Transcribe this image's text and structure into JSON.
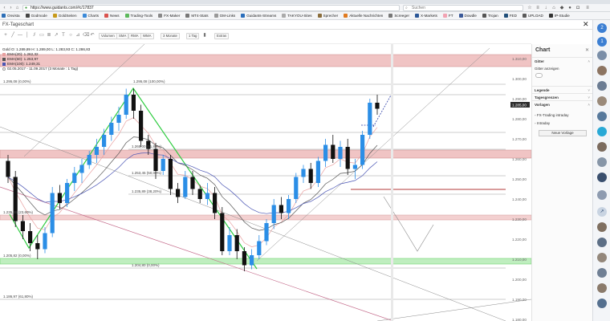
{
  "browser": {
    "url": "https://www.guidants.com/#c/17837",
    "search_placeholder": "Suchen",
    "bookmarks": [
      {
        "label": "Onvista",
        "color": "#2d6fb7"
      },
      {
        "label": "Godmode",
        "color": "#444444"
      },
      {
        "label": "GoldSeiten",
        "color": "#c79a1a"
      },
      {
        "label": "Charts",
        "color": "#3c8ad8"
      },
      {
        "label": "News",
        "color": "#d9534f"
      },
      {
        "label": "Trading-Tools",
        "color": "#5cb85c"
      },
      {
        "label": "FX-Maker",
        "color": "#888888"
      },
      {
        "label": "MT4-Stats",
        "color": "#777777"
      },
      {
        "label": "GM-Links",
        "color": "#999999"
      },
      {
        "label": "Guidants-Streams",
        "color": "#2a6ebb"
      },
      {
        "label": "TAKYOU-Sites",
        "color": "#aaaaaa"
      },
      {
        "label": "Sprecher",
        "color": "#8a6d3b"
      },
      {
        "label": "Aktuelle Nachrichten",
        "color": "#e07a1f"
      },
      {
        "label": "Screeger",
        "color": "#777777"
      },
      {
        "label": "X-Markets",
        "color": "#2b5797"
      },
      {
        "label": "FT",
        "color": "#f2a3b3"
      },
      {
        "label": "Dowdle",
        "color": "#3b5998"
      },
      {
        "label": "Trojan",
        "color": "#555555"
      },
      {
        "label": "FED",
        "color": "#1f4e79"
      },
      {
        "label": "UPLOAD",
        "color": "#5a5a5a"
      },
      {
        "label": "IP-Studie",
        "color": "#333333"
      }
    ]
  },
  "app": {
    "title": "FX-Tageschart"
  },
  "toolbar": {
    "buttons": [
      "Volumen",
      "SMA",
      "RMA",
      "WMA",
      "3 Monate",
      "1 Tag",
      "Extras"
    ]
  },
  "legend": {
    "line1": "Gold  O: 1.289,89  H: 1.289,00  L: 1.283,93  C: 1.286,83",
    "line2": "EMA(20): 1.262,32",
    "line3": "EMA(50): 1.253,97",
    "line4": "EMA(100): 1.249,31",
    "line5": "02.05.2017 - 11.09.2017   (3 Monate : 1 Tag)",
    "colors": {
      "ema20": "#e8a0a0",
      "ema50": "#555555",
      "ema100": "#4b56b5"
    }
  },
  "axis": {
    "labels": [
      "1.310,00",
      "1.300,00",
      "1.290,00",
      "1.280,00",
      "1.270,00",
      "1.260,00",
      "1.250,00",
      "1.240,00",
      "1.230,00",
      "1.220,00",
      "1.210,00",
      "1.200,00",
      "1.190,00",
      "1.180,00"
    ],
    "current_price": "1.285,00"
  },
  "fib": {
    "top": "1.295,08 (100,00%)",
    "left_top": "1.295,08 (0,00%)",
    "l1": "1.265,00 (61,80%)",
    "l2": "1.253,45 (50,00%)",
    "l3": "1.235,89 (38,20%)",
    "left_mid": "1.235,89 (23,60%)",
    "left_low": "1.205,82 (0,00%)",
    "bottom": "1.204,80 (0,00%)",
    "far_low": "1.186,97 (61,80%)"
  },
  "candles": [
    {
      "o": 1259,
      "h": 1262,
      "l": 1248,
      "c": 1251
    },
    {
      "o": 1251,
      "h": 1254,
      "l": 1226,
      "c": 1229
    },
    {
      "o": 1229,
      "h": 1232,
      "l": 1220,
      "c": 1224
    },
    {
      "o": 1224,
      "h": 1228,
      "l": 1214,
      "c": 1218
    },
    {
      "o": 1218,
      "h": 1222,
      "l": 1210,
      "c": 1215
    },
    {
      "o": 1215,
      "h": 1226,
      "l": 1213,
      "c": 1223
    },
    {
      "o": 1223,
      "h": 1246,
      "l": 1221,
      "c": 1243
    },
    {
      "o": 1243,
      "h": 1247,
      "l": 1235,
      "c": 1238
    },
    {
      "o": 1238,
      "h": 1250,
      "l": 1236,
      "c": 1248
    },
    {
      "o": 1248,
      "h": 1256,
      "l": 1244,
      "c": 1253
    },
    {
      "o": 1253,
      "h": 1260,
      "l": 1248,
      "c": 1257
    },
    {
      "o": 1257,
      "h": 1264,
      "l": 1255,
      "c": 1262
    },
    {
      "o": 1262,
      "h": 1270,
      "l": 1258,
      "c": 1266
    },
    {
      "o": 1266,
      "h": 1275,
      "l": 1262,
      "c": 1272
    },
    {
      "o": 1272,
      "h": 1281,
      "l": 1269,
      "c": 1278
    },
    {
      "o": 1278,
      "h": 1286,
      "l": 1274,
      "c": 1282
    },
    {
      "o": 1282,
      "h": 1295,
      "l": 1280,
      "c": 1292
    },
    {
      "o": 1292,
      "h": 1295,
      "l": 1280,
      "c": 1284
    },
    {
      "o": 1284,
      "h": 1287,
      "l": 1266,
      "c": 1269
    },
    {
      "o": 1269,
      "h": 1272,
      "l": 1262,
      "c": 1265
    },
    {
      "o": 1265,
      "h": 1268,
      "l": 1250,
      "c": 1254
    },
    {
      "o": 1254,
      "h": 1262,
      "l": 1252,
      "c": 1260
    },
    {
      "o": 1260,
      "h": 1262,
      "l": 1242,
      "c": 1245
    },
    {
      "o": 1245,
      "h": 1248,
      "l": 1238,
      "c": 1241
    },
    {
      "o": 1241,
      "h": 1254,
      "l": 1240,
      "c": 1251
    },
    {
      "o": 1251,
      "h": 1254,
      "l": 1242,
      "c": 1245
    },
    {
      "o": 1245,
      "h": 1247,
      "l": 1238,
      "c": 1240
    },
    {
      "o": 1240,
      "h": 1248,
      "l": 1237,
      "c": 1243
    },
    {
      "o": 1243,
      "h": 1246,
      "l": 1230,
      "c": 1233
    },
    {
      "o": 1233,
      "h": 1236,
      "l": 1212,
      "c": 1214
    },
    {
      "o": 1214,
      "h": 1226,
      "l": 1212,
      "c": 1222
    },
    {
      "o": 1222,
      "h": 1225,
      "l": 1210,
      "c": 1214
    },
    {
      "o": 1214,
      "h": 1216,
      "l": 1204,
      "c": 1207
    },
    {
      "o": 1207,
      "h": 1215,
      "l": 1205,
      "c": 1212
    },
    {
      "o": 1212,
      "h": 1222,
      "l": 1210,
      "c": 1219
    },
    {
      "o": 1219,
      "h": 1230,
      "l": 1217,
      "c": 1228
    },
    {
      "o": 1228,
      "h": 1240,
      "l": 1225,
      "c": 1237
    },
    {
      "o": 1237,
      "h": 1241,
      "l": 1230,
      "c": 1233
    },
    {
      "o": 1233,
      "h": 1242,
      "l": 1230,
      "c": 1240
    },
    {
      "o": 1240,
      "h": 1253,
      "l": 1238,
      "c": 1251
    },
    {
      "o": 1251,
      "h": 1257,
      "l": 1248,
      "c": 1255
    },
    {
      "o": 1255,
      "h": 1258,
      "l": 1245,
      "c": 1248
    },
    {
      "o": 1248,
      "h": 1261,
      "l": 1246,
      "c": 1259
    },
    {
      "o": 1259,
      "h": 1270,
      "l": 1256,
      "c": 1267
    },
    {
      "o": 1267,
      "h": 1272,
      "l": 1258,
      "c": 1260
    },
    {
      "o": 1260,
      "h": 1269,
      "l": 1256,
      "c": 1266
    },
    {
      "o": 1266,
      "h": 1270,
      "l": 1252,
      "c": 1255
    },
    {
      "o": 1255,
      "h": 1260,
      "l": 1250,
      "c": 1257
    },
    {
      "o": 1257,
      "h": 1274,
      "l": 1255,
      "c": 1272
    },
    {
      "o": 1272,
      "h": 1290,
      "l": 1270,
      "c": 1288
    },
    {
      "o": 1288,
      "h": 1292,
      "l": 1282,
      "c": 1285
    }
  ],
  "panel": {
    "title": "Chart",
    "sections": {
      "gitter": "Gitter",
      "legende": "Legende",
      "tagesgrenzen": "Tagesgrenzen",
      "vorlagen": "Vorlagen"
    },
    "gitter_anzeigen": "Gitter anzeigen",
    "template1": "FX-Trading intraday",
    "template2": "Intraday",
    "new_template": "Neue Vorlage"
  },
  "rail_badges": [
    "2",
    "1"
  ]
}
